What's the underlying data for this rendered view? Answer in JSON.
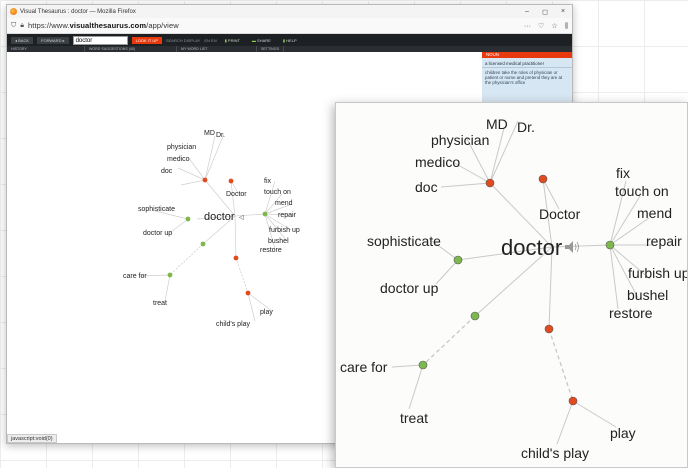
{
  "browser": {
    "window_title": "Visual Thesaurus : doctor — Mozilla Firefox",
    "url_prefix": "https://www.",
    "url_domain": "visualthesaurus.com",
    "url_path": "/app/view",
    "window_buttons": [
      "–",
      "◻",
      "×"
    ]
  },
  "toolbar": {
    "back_label": "◂ BACK",
    "forward_label": "FORWARD ▸",
    "search_value": "doctor",
    "lookup_label": "LOOK IT UP",
    "search_display_label": "SEARCH DISPLAY",
    "en_label": "EN EN",
    "print_label": "PRINT",
    "share_label": "SHARE",
    "help_label": "HELP"
  },
  "subtabs": [
    "HISTORY",
    "WORD SUGGESTIONS (40)",
    "MY WORD LIST",
    "SETTINGS"
  ],
  "sidepanel": {
    "header": "NOUN",
    "definition": "a licensed medical practitioner",
    "example": "children take the roles of physician or patient or nurse and pretend they are at the physician's office"
  },
  "status_text": "javascript:void(0)",
  "graph": {
    "center": "doctor",
    "labels": {
      "md": "MD",
      "dr": "Dr.",
      "physician": "physician",
      "medico": "medico",
      "doc": "doc",
      "doctor_cap": "Doctor",
      "sophisticate": "sophisticate",
      "doctor_up": "doctor up",
      "care_for": "care for",
      "treat": "treat",
      "play": "play",
      "childs_play": "child's play",
      "fix": "fix",
      "touch_on": "touch on",
      "mend": "mend",
      "repair": "repair",
      "furbish_up": "furbish up",
      "bushel": "bushel",
      "restore": "restore"
    }
  },
  "colors": {
    "noun_node": "#e24a1f",
    "verb_node": "#7db84f",
    "link": "#c8c8c8",
    "accent": "#e8380d"
  }
}
